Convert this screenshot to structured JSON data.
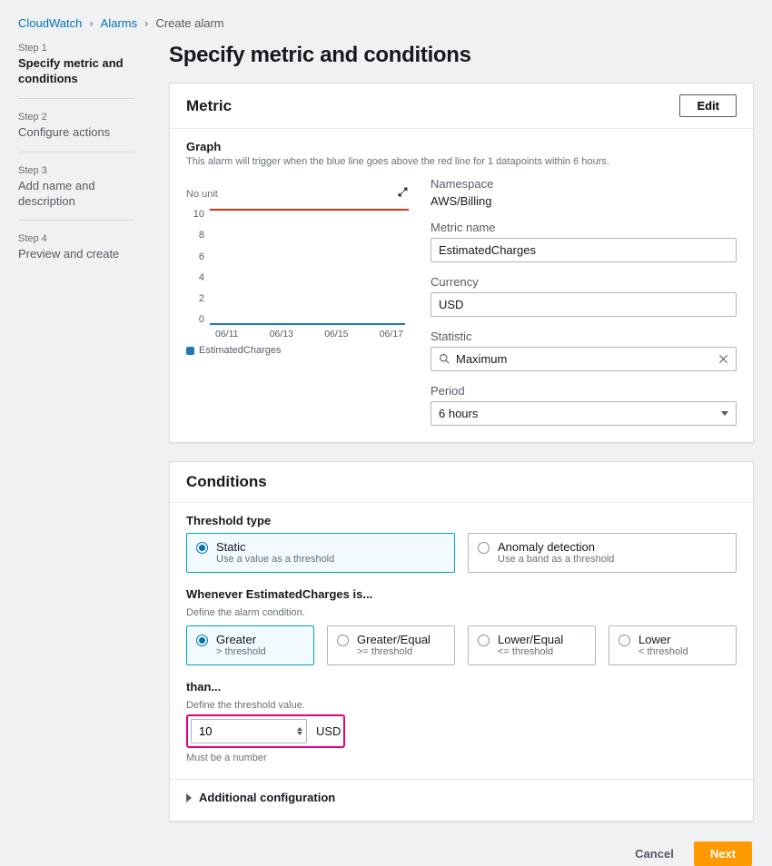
{
  "breadcrumb": {
    "root": "CloudWatch",
    "section": "Alarms",
    "current": "Create alarm"
  },
  "sidebar": {
    "steps": [
      {
        "n": "Step 1",
        "title": "Specify metric and conditions"
      },
      {
        "n": "Step 2",
        "title": "Configure actions"
      },
      {
        "n": "Step 3",
        "title": "Add name and description"
      },
      {
        "n": "Step 4",
        "title": "Preview and create"
      }
    ]
  },
  "page": {
    "title": "Specify metric and conditions"
  },
  "metric_panel": {
    "header": "Metric",
    "edit_label": "Edit",
    "graph": {
      "title": "Graph",
      "hint": "This alarm will trigger when the blue line goes above the red line for 1 datapoints within 6 hours.",
      "unit": "No unit",
      "legend": "EstimatedCharges"
    },
    "fields": {
      "namespace_label": "Namespace",
      "namespace_value": "AWS/Billing",
      "metric_name_label": "Metric name",
      "metric_name_value": "EstimatedCharges",
      "currency_label": "Currency",
      "currency_value": "USD",
      "statistic_label": "Statistic",
      "statistic_value": "Maximum",
      "period_label": "Period",
      "period_value": "6 hours"
    }
  },
  "conditions_panel": {
    "header": "Conditions",
    "threshold_type_label": "Threshold type",
    "threshold_type_options": [
      {
        "title": "Static",
        "sub": "Use a value as a threshold"
      },
      {
        "title": "Anomaly detection",
        "sub": "Use a band as a threshold"
      }
    ],
    "whenever_label": "Whenever EstimatedCharges is...",
    "whenever_hint": "Define the alarm condition.",
    "operator_options": [
      {
        "title": "Greater",
        "sub": "> threshold"
      },
      {
        "title": "Greater/Equal",
        "sub": ">= threshold"
      },
      {
        "title": "Lower/Equal",
        "sub": "<= threshold"
      },
      {
        "title": "Lower",
        "sub": "< threshold"
      }
    ],
    "than_label": "than...",
    "than_hint": "Define the threshold value.",
    "than_value": "10",
    "than_unit": "USD",
    "than_helper": "Must be a number",
    "additional_label": "Additional configuration"
  },
  "footer": {
    "cancel": "Cancel",
    "next": "Next"
  },
  "chart_data": {
    "type": "line",
    "x": [
      "06/11",
      "06/13",
      "06/15",
      "06/17"
    ],
    "series": [
      {
        "name": "EstimatedCharges",
        "values": [
          0,
          0,
          0,
          0
        ],
        "color": "#1f77b4"
      },
      {
        "name": "Threshold",
        "values": [
          10,
          10,
          10,
          10
        ],
        "color": "#d13212"
      }
    ],
    "ylim": [
      0,
      10
    ],
    "yticks": [
      0,
      2,
      4,
      6,
      8,
      10
    ],
    "ylabel": "No unit",
    "xlabel": ""
  }
}
